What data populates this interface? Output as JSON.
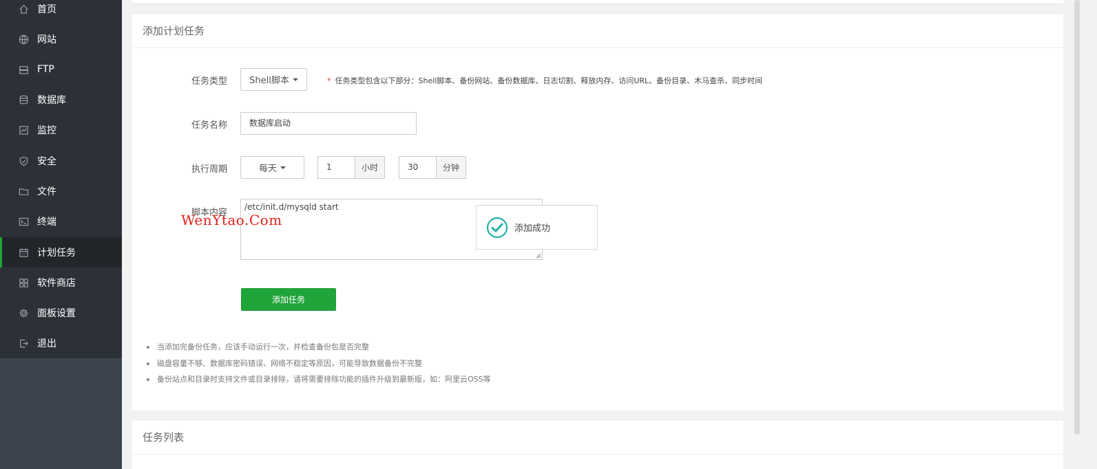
{
  "sidebar": {
    "items": [
      {
        "label": "首页",
        "icon": "home-icon"
      },
      {
        "label": "网站",
        "icon": "globe-icon"
      },
      {
        "label": "FTP",
        "icon": "ftp-icon"
      },
      {
        "label": "数据库",
        "icon": "database-icon"
      },
      {
        "label": "监控",
        "icon": "monitor-icon"
      },
      {
        "label": "安全",
        "icon": "shield-icon"
      },
      {
        "label": "文件",
        "icon": "folder-icon"
      },
      {
        "label": "终端",
        "icon": "terminal-icon"
      },
      {
        "label": "计划任务",
        "icon": "calendar-icon",
        "active": true
      },
      {
        "label": "软件商店",
        "icon": "apps-icon"
      },
      {
        "label": "面板设置",
        "icon": "gear-icon"
      },
      {
        "label": "退出",
        "icon": "logout-icon"
      }
    ]
  },
  "form": {
    "title": "添加计划任务",
    "task_type_label": "任务类型",
    "task_type_value": "Shell脚本",
    "task_type_hint": "任务类型包含以下部分：Shell脚本、备份网站、备份数据库、日志切割、释放内存、访问URL、备份目录、木马查杀、同步时间",
    "task_type_hint_star": "*",
    "task_name_label": "任务名称",
    "task_name_value": "数据库启动",
    "period_label": "执行周期",
    "period_value": "每天",
    "hour_value": "1",
    "hour_unit": "小时",
    "minute_value": "30",
    "minute_unit": "分钟",
    "script_label": "脚本内容",
    "script_value": "/etc/init.d/mysqld start",
    "submit_label": "添加任务"
  },
  "notes": [
    "当添加完备份任务，应该手动运行一次，并检查备份包是否完整",
    "磁盘容量不够、数据库密码错误、网络不稳定等原因，可能导致数据备份不完整",
    "备份站点和目录时支持文件或目录排除，请将需要排除功能的插件升级到最新版，如：阿里云OSS等"
  ],
  "toast": {
    "message": "添加成功",
    "icon": "check-circle-icon",
    "color": "#20b2aa"
  },
  "watermark": "WenYtao.Com",
  "task_list": {
    "title": "任务列表"
  },
  "colors": {
    "accent": "#20a53a",
    "sidebar": "#2c3138"
  }
}
